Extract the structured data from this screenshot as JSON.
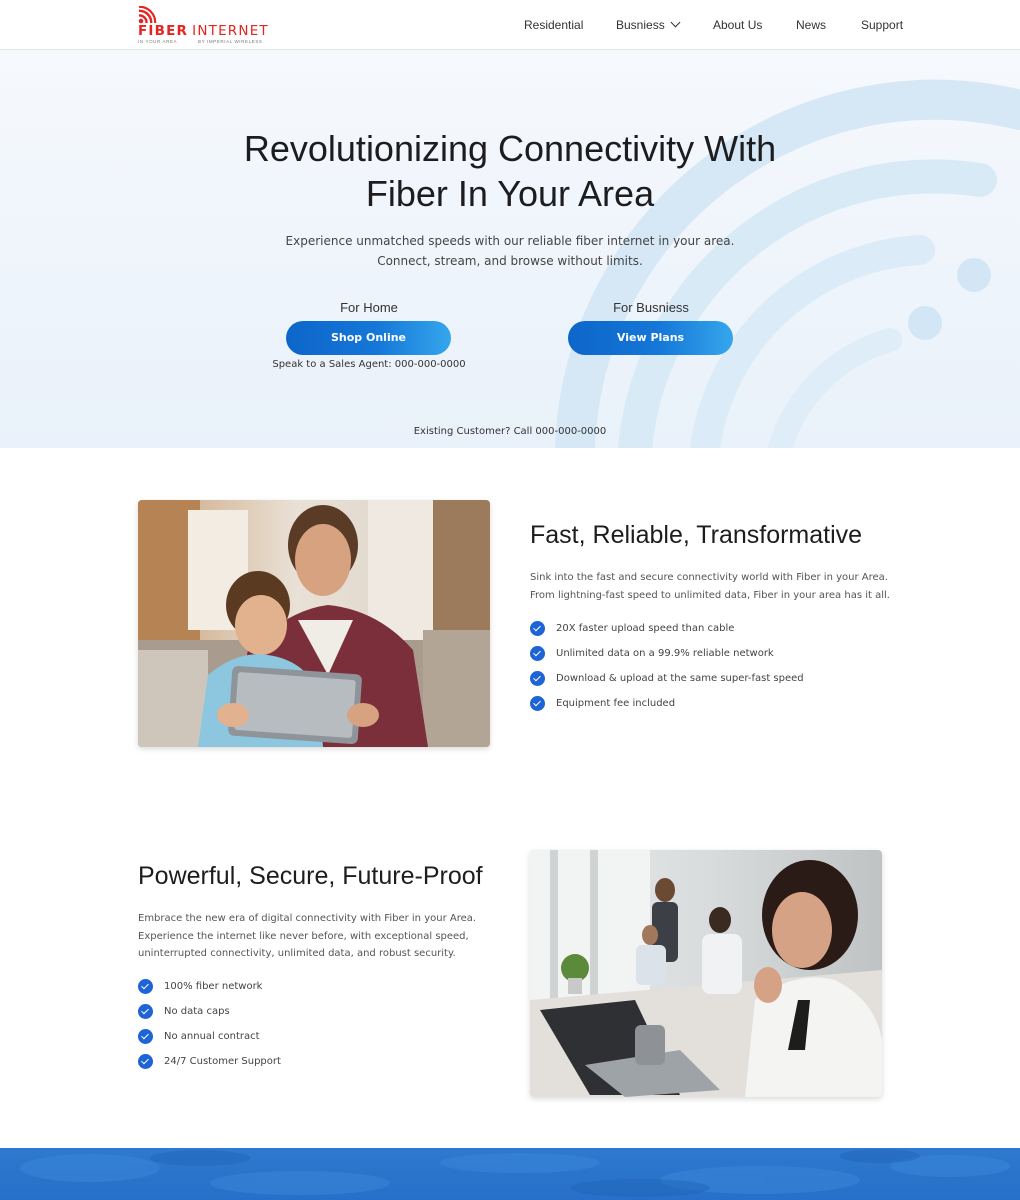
{
  "header": {
    "logo": {
      "brand_first": "FIBER",
      "brand_second": "INTERNET",
      "tagline_left": "IN YOUR AREA",
      "tagline_right": "BY IMPERIAL WIRELESS",
      "color": "#e52421"
    },
    "nav": [
      {
        "label": "Residential"
      },
      {
        "label": "Busniess",
        "has_dropdown": true
      },
      {
        "label": "About Us"
      },
      {
        "label": "News"
      },
      {
        "label": "Support"
      }
    ]
  },
  "hero": {
    "title_line1": "Revolutionizing Connectivity With",
    "title_line2": "Fiber In Your Area",
    "subtitle_line1": "Experience unmatched speeds with our reliable fiber internet in your area.",
    "subtitle_line2": "Connect, stream, and browse without limits.",
    "home": {
      "label": "For Home",
      "button": "Shop Online"
    },
    "business": {
      "label": "For Busniess",
      "button": "View Plans"
    },
    "agent": "Speak to a Sales Agent: 000-000-0000",
    "existing": "Existing Customer? Call 000-000-0000",
    "accent_color": "#1577d8"
  },
  "section1": {
    "title": "Fast, Reliable, Transformative",
    "desc_line1": "Sink into the fast and secure connectivity world with Fiber in your Area.",
    "desc_line2": "From lightning-fast speed to unlimited data, Fiber in your area has it all.",
    "features": [
      "20X faster upload speed than cable",
      "Unlimited data on a 99.9% reliable network",
      "Download & upload at the same super-fast speed",
      "Equipment fee included"
    ],
    "image_icon": "family-tablet-photo"
  },
  "section2": {
    "title": "Powerful, Secure, Future-Proof",
    "desc_line1": "Embrace the new era of digital connectivity with Fiber in your Area.",
    "desc_line2": "Experience the internet like never before, with exceptional speed,",
    "desc_line3": "uninterrupted connectivity, unlimited data, and robust security.",
    "features": [
      "100% fiber network",
      "No data caps",
      "No annual contract",
      "24/7 Customer Support"
    ],
    "image_icon": "office-workers-photo"
  },
  "colors": {
    "check": "#1e64d6",
    "band": "#2f79cf"
  }
}
